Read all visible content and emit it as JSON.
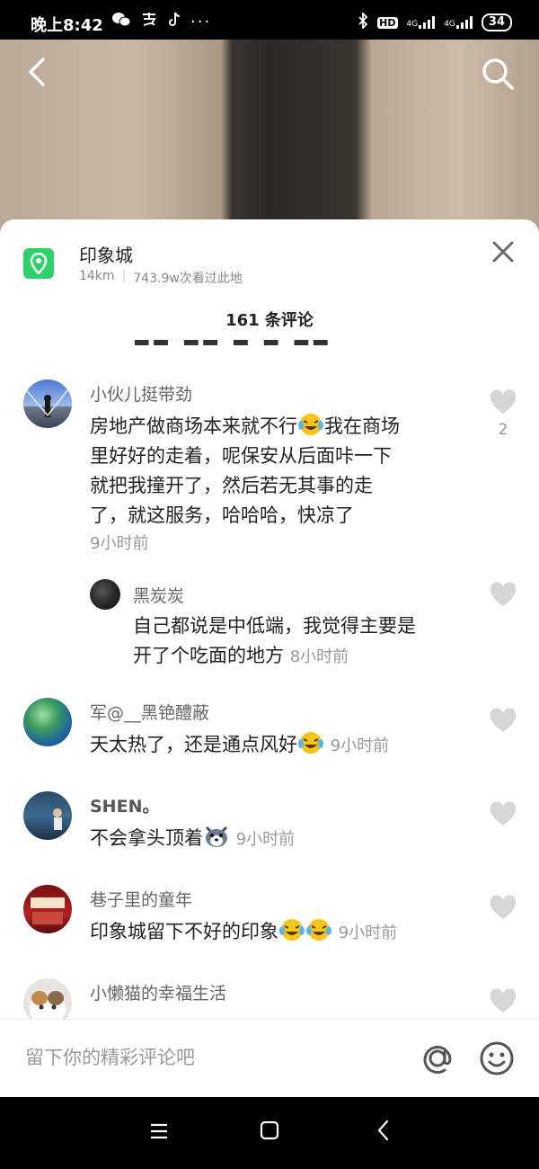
{
  "status": {
    "time": "晚上8:42",
    "battery": "34",
    "hd": "HD",
    "signal1": "4G",
    "signal2": "4G"
  },
  "location": {
    "name": "印象城",
    "distance": "14km",
    "separator": "|",
    "views": "743.9w次看过此地"
  },
  "comments_title": "161 条评论",
  "comments": [
    {
      "name": "小伙儿挺带劲",
      "text_lines": [
        "房地产做商场本来就不行",
        "我在商场",
        "里好好的走着，呢保安从后面咔一下",
        "就把我撞开了，然后若无其事的走",
        "了，就这服务，哈哈哈，快凉了"
      ],
      "time": "9小时前",
      "likes": "2"
    },
    {
      "name": "黑炭炭",
      "text_lines": [
        "自己都说是中低端，我觉得主要是",
        "开了个吃面的地方"
      ],
      "time": "8小时前"
    },
    {
      "name": "军@__黑铯醴蔽",
      "text": "天太热了，还是通点风好",
      "time": "9小时前"
    },
    {
      "name": "SHEN。",
      "text": "不会拿头顶着",
      "time": "9小时前"
    },
    {
      "name": "巷子里的童年",
      "text": "印象城留下不好的印象",
      "time": "9小时前"
    },
    {
      "name": "小懒猫的幸福生活"
    }
  ],
  "input": {
    "placeholder": "留下你的精彩评论吧"
  },
  "colors": {
    "location_icon": "#2fd06a",
    "emoji_face": "#f5c518"
  }
}
